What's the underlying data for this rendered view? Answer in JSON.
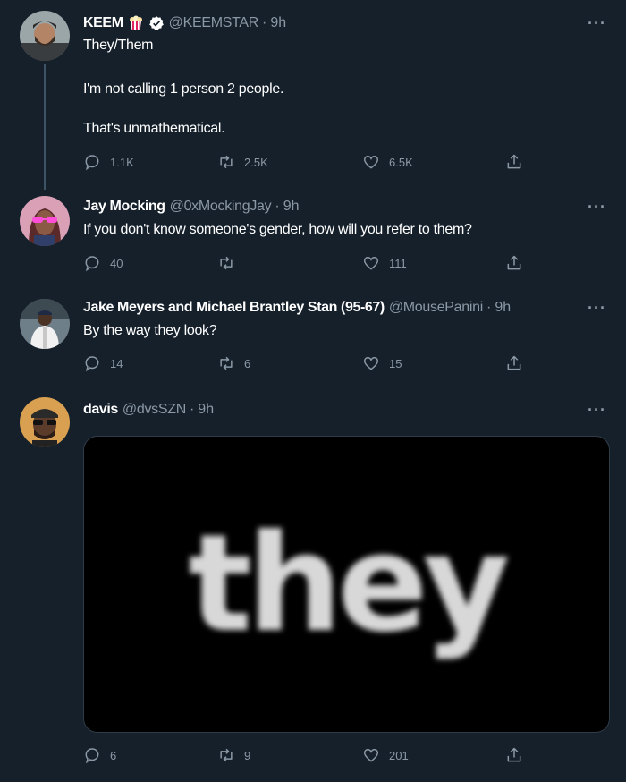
{
  "thread": [
    {
      "name": "KEEM",
      "handle": "@KEEMSTAR",
      "time": "9h",
      "lines": [
        "They/Them",
        "I'm not calling 1 person 2 people.",
        "That's unmathematical."
      ],
      "replies": "1.1K",
      "retweets": "2.5K",
      "likes": "6.5K"
    },
    {
      "name": "Jay Mocking",
      "handle": "@0xMockingJay",
      "time": "9h",
      "text": "If you don't know someone's gender, how will you refer to them?",
      "replies": "40",
      "retweets": "",
      "likes": "111"
    },
    {
      "name": "Jake Meyers and Michael Brantley Stan (95-67)",
      "handle": "@MousePanini",
      "time": "9h",
      "text": "By the way they look?",
      "replies": "14",
      "retweets": "6",
      "likes": "15"
    },
    {
      "name": "davis",
      "handle": "@dvsSZN",
      "time": "9h",
      "media_text": "they",
      "replies": "6",
      "retweets": "9",
      "likes": "201"
    }
  ],
  "more_label": "···",
  "colors": {
    "background": "#15202b",
    "secondary_text": "#8b98a5",
    "thread_line": "#3d5466"
  }
}
